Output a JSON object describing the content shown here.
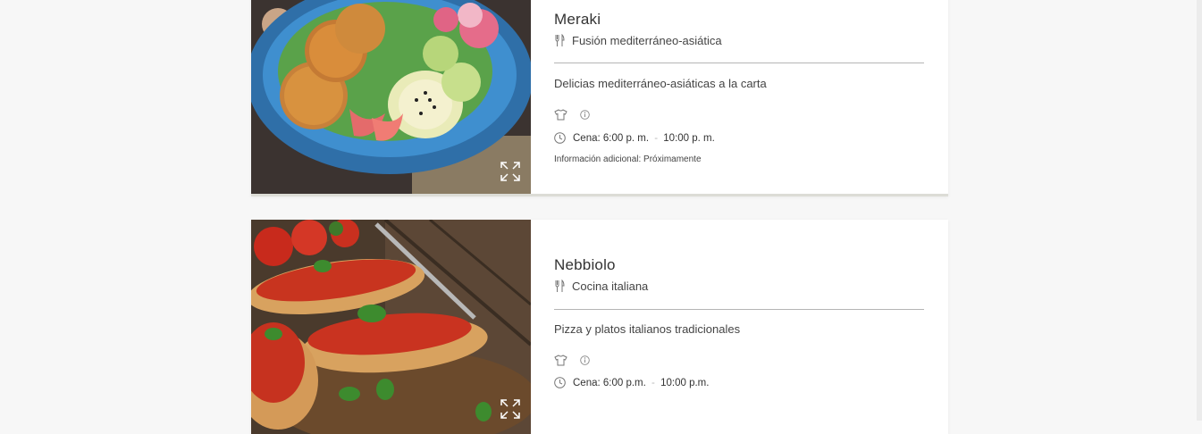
{
  "restaurants": [
    {
      "name": "Meraki",
      "cuisine": "Fusión mediterráneo-asiática",
      "description": "Delicias mediterráneo-asiáticas a la carta",
      "hours_label": "Cena:",
      "hours_open": "6:00 p. m.",
      "hours_sep": "-",
      "hours_close": "10:00 p. m.",
      "additional_info": "Información adicional: Próximamente"
    },
    {
      "name": "Nebbiolo",
      "cuisine": "Cocina italiana",
      "description": "Pizza y platos italianos tradicionales",
      "hours_label": "Cena:",
      "hours_open": "6:00 p.m.",
      "hours_sep": "-",
      "hours_close": "10:00 p.m."
    }
  ],
  "icons": {
    "cuisine": "utensils-icon",
    "dress_code": "shirt-icon",
    "info": "info-icon",
    "hours": "clock-icon",
    "expand": "expand-icon"
  },
  "colors": {
    "background": "#f7f7f7",
    "card": "#ffffff",
    "divider": "#b5b5b5",
    "text": "#333333"
  }
}
